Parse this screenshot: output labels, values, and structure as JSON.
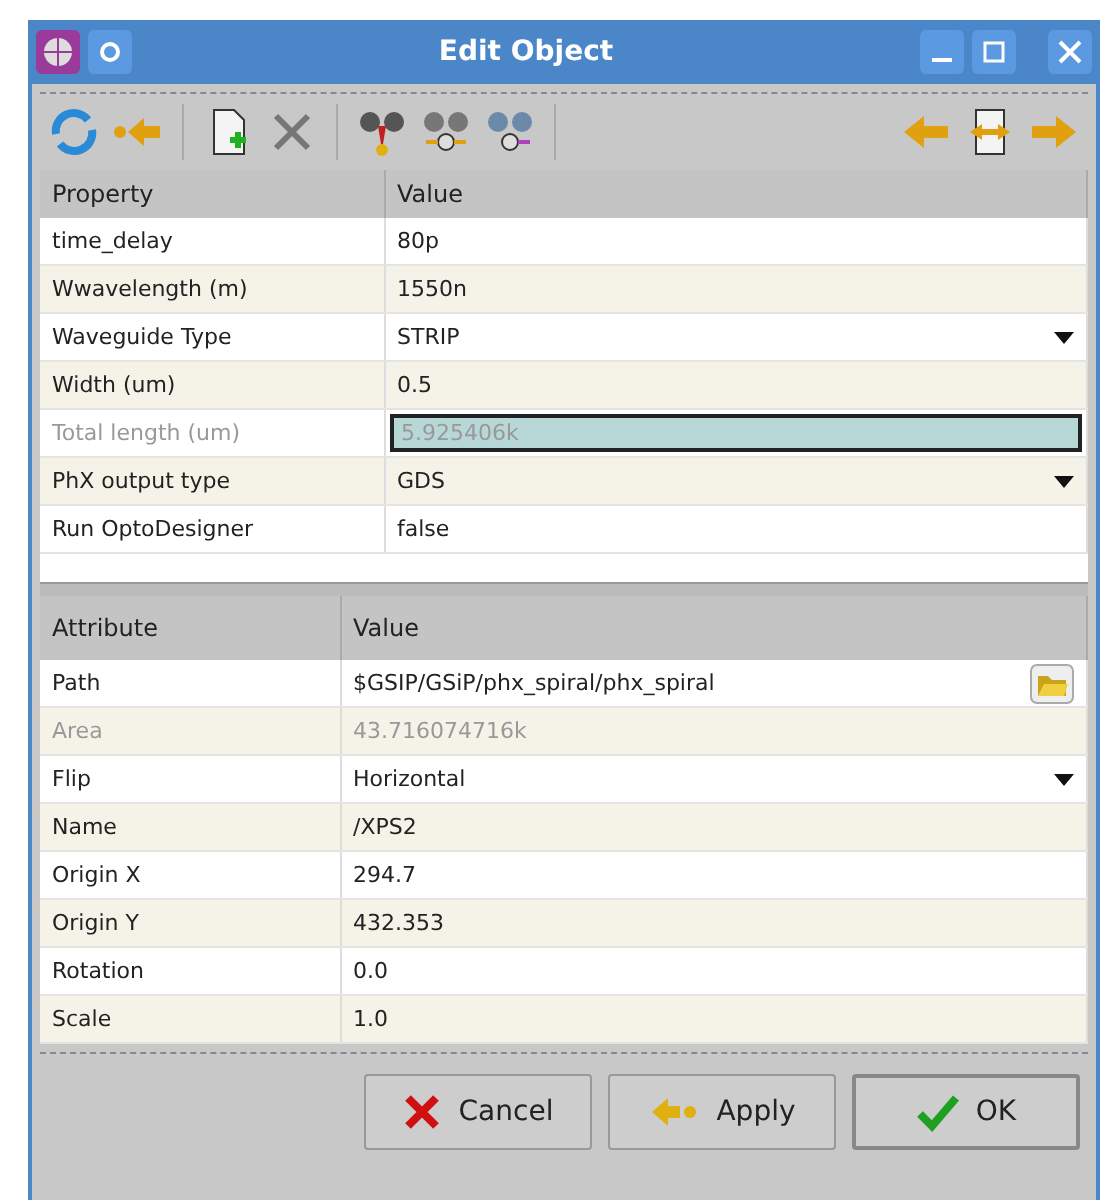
{
  "window": {
    "title": "Edit Object"
  },
  "properties": {
    "columns": [
      "Property",
      "Value"
    ],
    "rows": [
      {
        "name": "time_delay",
        "value": "80p",
        "kind": "text",
        "disabled": false
      },
      {
        "name": "Wwavelength (m)",
        "value": "1550n",
        "kind": "text",
        "disabled": false
      },
      {
        "name": "Waveguide Type",
        "value": "STRIP",
        "kind": "dropdown",
        "disabled": false
      },
      {
        "name": "Width (um)",
        "value": "0.5",
        "kind": "text",
        "disabled": false
      },
      {
        "name": "Total length (um)",
        "value": "5.925406k",
        "kind": "field",
        "disabled": true
      },
      {
        "name": "PhX output type",
        "value": "GDS",
        "kind": "dropdown",
        "disabled": false
      },
      {
        "name": "Run OptoDesigner",
        "value": "false",
        "kind": "text",
        "disabled": false
      }
    ]
  },
  "attributes": {
    "columns": [
      "Attribute",
      "Value"
    ],
    "rows": [
      {
        "name": "Path",
        "value": "$GSIP/GSiP/phx_spiral/phx_spiral",
        "kind": "browse",
        "disabled": false
      },
      {
        "name": "Area",
        "value": "43.716074716k",
        "kind": "text",
        "disabled": true
      },
      {
        "name": "Flip",
        "value": "Horizontal",
        "kind": "dropdown",
        "disabled": false
      },
      {
        "name": "Name",
        "value": "/XPS2",
        "kind": "text",
        "disabled": false
      },
      {
        "name": "Origin X",
        "value": "294.7",
        "kind": "text",
        "disabled": false
      },
      {
        "name": "Origin Y",
        "value": "432.353",
        "kind": "text",
        "disabled": false
      },
      {
        "name": "Rotation",
        "value": "0.0",
        "kind": "text",
        "disabled": false
      },
      {
        "name": "Scale",
        "value": "1.0",
        "kind": "text",
        "disabled": false
      }
    ]
  },
  "buttons": [
    {
      "label": "Cancel",
      "kind": "cancel"
    },
    {
      "label": "Apply",
      "kind": "apply"
    },
    {
      "label": "OK",
      "kind": "ok"
    }
  ]
}
